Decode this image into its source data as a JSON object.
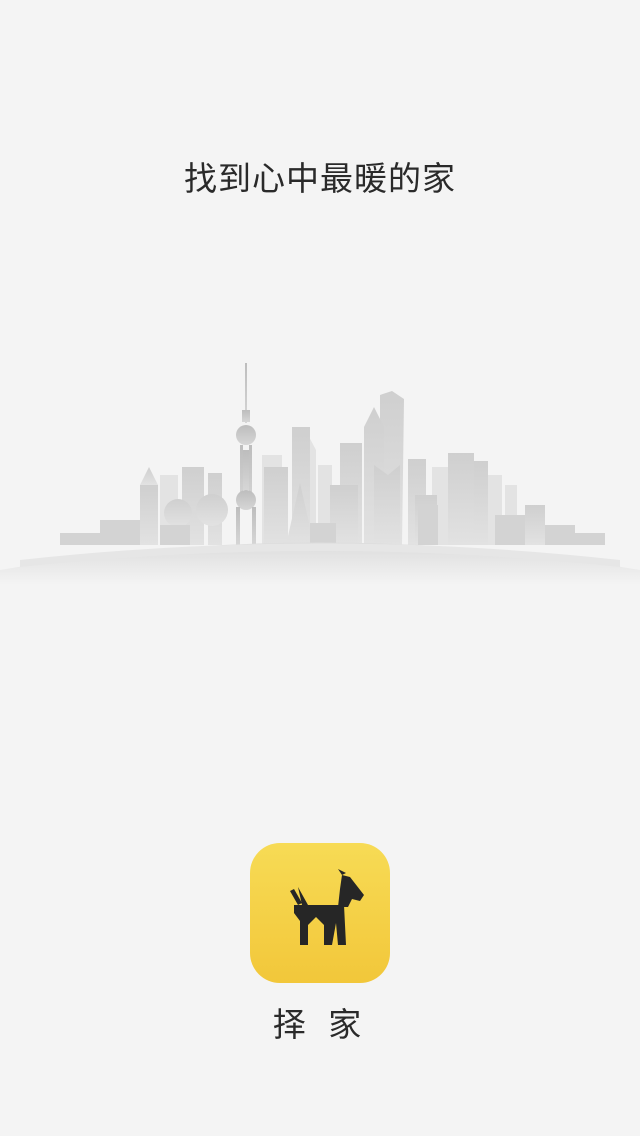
{
  "splash": {
    "slogan": "找到心中最暖的家",
    "app_name": "择 家",
    "icon": "dog-house-icon",
    "illustration": "city-skyline",
    "colors": {
      "background": "#f4f4f4",
      "icon_yellow": "#f2c73a",
      "icon_dark": "#262626",
      "text": "#2a2a2a"
    }
  }
}
